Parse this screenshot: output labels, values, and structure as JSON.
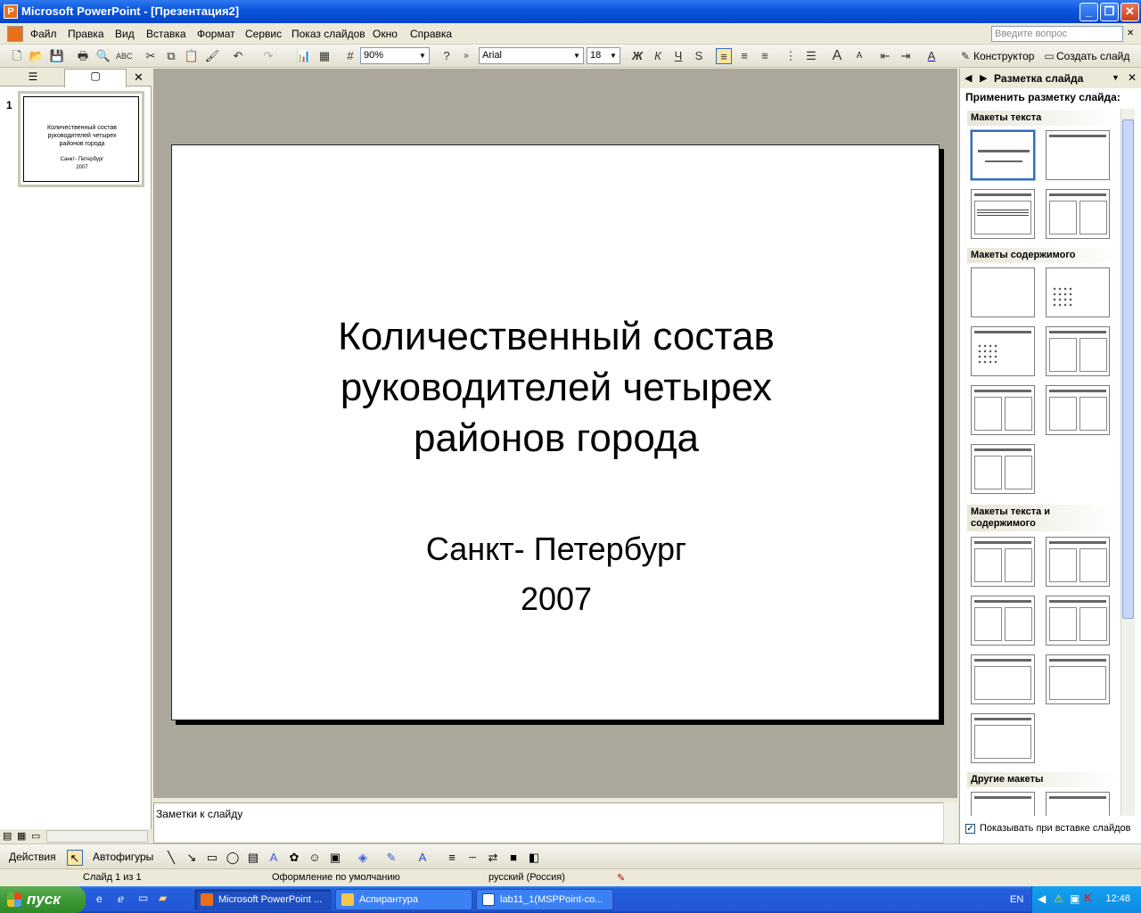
{
  "window": {
    "title": "Microsoft PowerPoint - [Презентация2]"
  },
  "menu": [
    "Файл",
    "Правка",
    "Вид",
    "Вставка",
    "Формат",
    "Сервис",
    "Показ слайдов",
    "Окно",
    "Справка"
  ],
  "help_placeholder": "Введите вопрос",
  "toolbar": {
    "zoom": "90%",
    "font": "Arial",
    "size": "18",
    "bold": "Ж",
    "italic": "К",
    "underline": "Ч",
    "shadow": "S",
    "designer": "Конструктор",
    "new_slide": "Создать слайд"
  },
  "slides_panel": {
    "slide_number": "1",
    "thumb_title": "Количественный состав руководителей четырех районов города",
    "thumb_sub": "Санкт- Петербург\n2007"
  },
  "slide": {
    "title": "Количественный состав\nруководителей четырех\nрайонов города",
    "subtitle": "Санкт- Петербург\n2007"
  },
  "notes_placeholder": "Заметки к слайду",
  "task_pane": {
    "title": "Разметка слайда",
    "apply_label": "Применить разметку слайда:",
    "sections": [
      "Макеты текста",
      "Макеты содержимого",
      "Макеты текста и содержимого",
      "Другие макеты"
    ],
    "show_on_insert": "Показывать при вставке слайдов"
  },
  "drawing_toolbar": {
    "actions": "Действия",
    "autoshapes": "Автофигуры"
  },
  "status": {
    "slide": "Слайд 1 из 1",
    "design": "Оформление по умолчанию",
    "language": "русский (Россия)"
  },
  "taskbar": {
    "start": "пуск",
    "tasks": [
      "Microsoft PowerPoint ...",
      "Аспирантура",
      "lab11_1(MSPPoint-co..."
    ],
    "lang": "EN",
    "time": "12:48"
  }
}
